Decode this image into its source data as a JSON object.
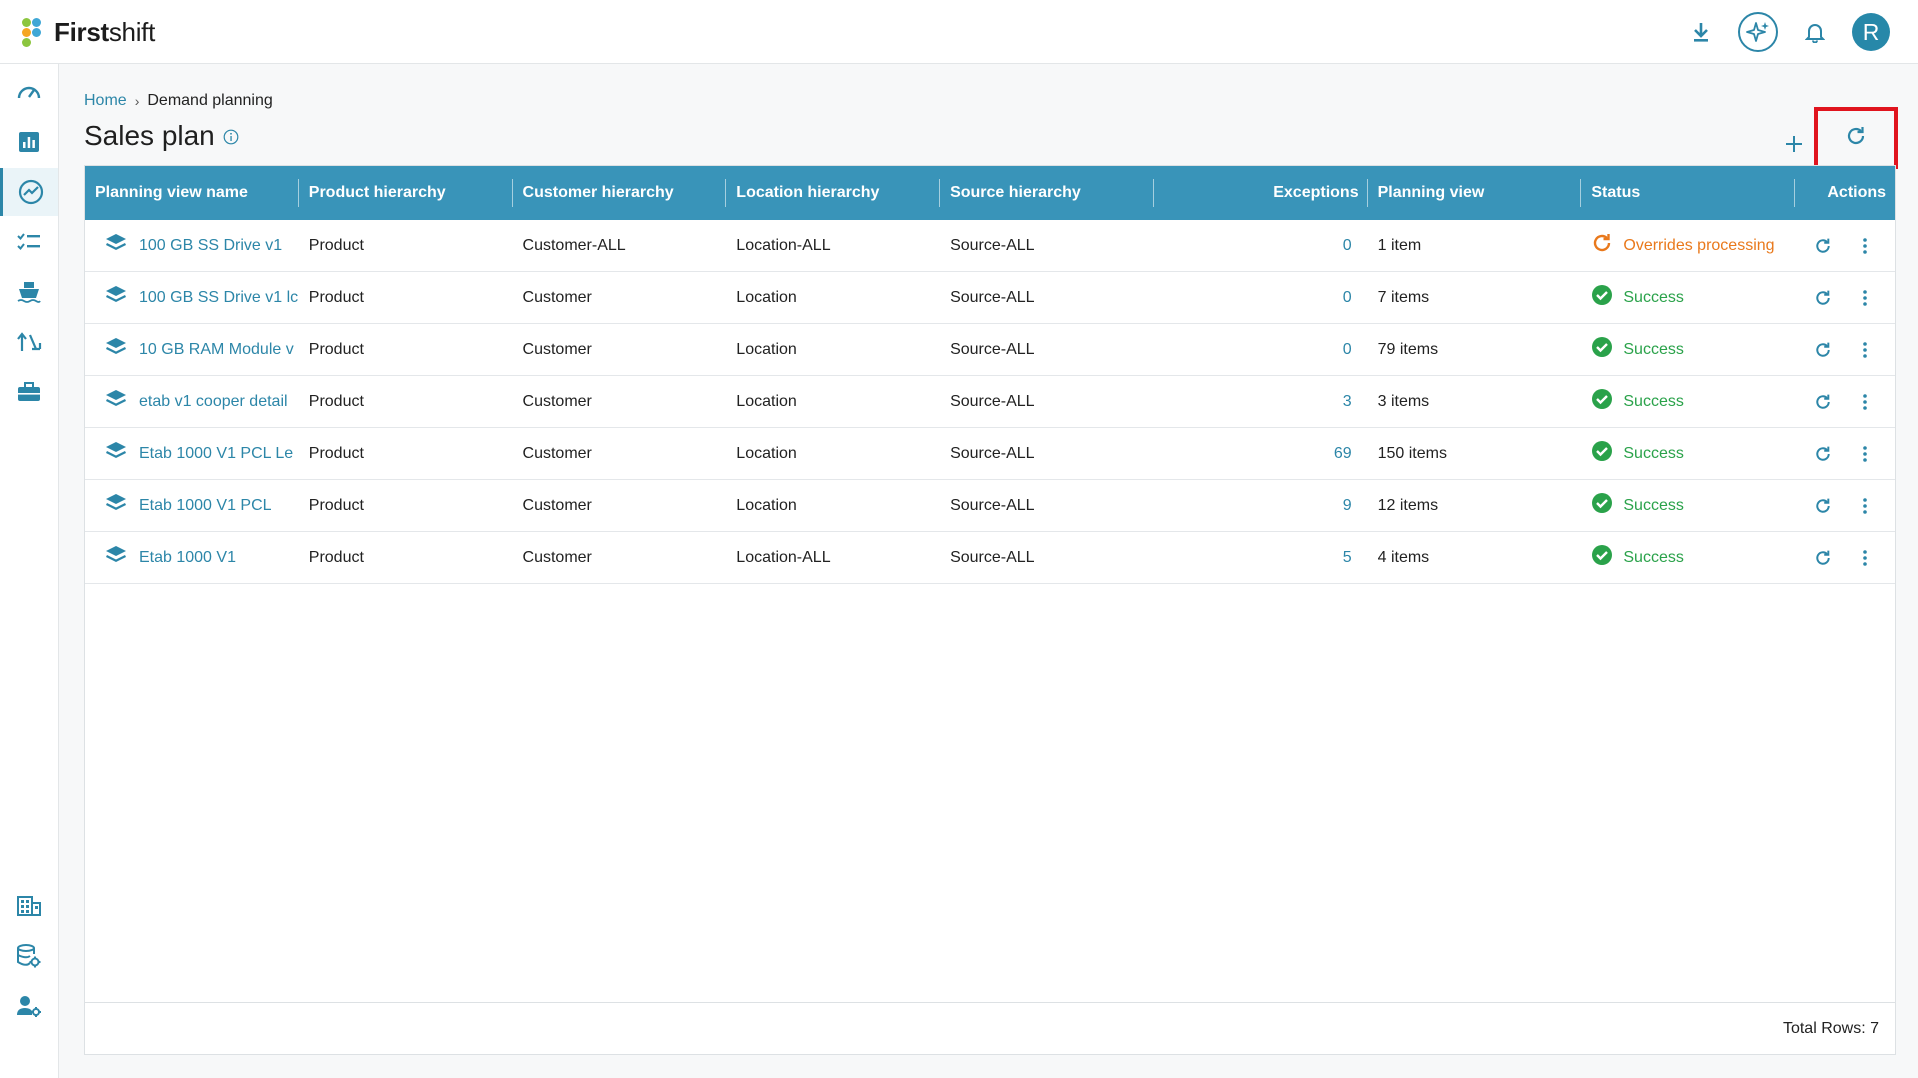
{
  "app": {
    "logo_text_bold": "First",
    "logo_text_light": "shift"
  },
  "colors": {
    "accent": "#2c86a8",
    "header_bg": "#3994b9",
    "success": "#2aa24a",
    "processing": "#e9791c",
    "highlight": "#e0141e"
  },
  "topbar": {
    "icons": [
      "download-icon",
      "ai-sparkle-icon",
      "bell-icon"
    ],
    "avatar_initial": "R"
  },
  "sidebar": {
    "items": [
      {
        "icon": "dashboard-gauge-icon"
      },
      {
        "icon": "bar-chart-icon"
      },
      {
        "icon": "trend-icon",
        "active": true
      },
      {
        "icon": "checklist-icon"
      },
      {
        "icon": "ship-icon"
      },
      {
        "icon": "route-icon"
      },
      {
        "icon": "briefcase-icon"
      },
      {
        "icon": "building-icon"
      },
      {
        "icon": "database-settings-icon"
      },
      {
        "icon": "user-settings-icon"
      }
    ]
  },
  "breadcrumb": {
    "home": "Home",
    "separator": "›",
    "current": "Demand planning"
  },
  "page": {
    "title": "Sales plan"
  },
  "table": {
    "columns": [
      "Planning view name",
      "Product hierarchy",
      "Customer hierarchy",
      "Location hierarchy",
      "Source hierarchy",
      "Exceptions",
      "Planning view",
      "Status",
      "Actions"
    ],
    "rows": [
      {
        "name": "100 GB SS Drive v1",
        "product": "Product",
        "customer": "Customer-ALL",
        "location": "Location-ALL",
        "source": "Source-ALL",
        "exceptions": "0",
        "planning_view": "1 item",
        "status": "Overrides processing",
        "status_type": "processing"
      },
      {
        "name": "100 GB SS Drive v1 lc",
        "product": "Product",
        "customer": "Customer",
        "location": "Location",
        "source": "Source-ALL",
        "exceptions": "0",
        "planning_view": "7 items",
        "status": "Success",
        "status_type": "success"
      },
      {
        "name": "10 GB RAM Module v",
        "product": "Product",
        "customer": "Customer",
        "location": "Location",
        "source": "Source-ALL",
        "exceptions": "0",
        "planning_view": "79 items",
        "status": "Success",
        "status_type": "success"
      },
      {
        "name": "etab v1 cooper detail",
        "product": "Product",
        "customer": "Customer",
        "location": "Location",
        "source": "Source-ALL",
        "exceptions": "3",
        "planning_view": "3 items",
        "status": "Success",
        "status_type": "success"
      },
      {
        "name": "Etab 1000 V1 PCL Le",
        "product": "Product",
        "customer": "Customer",
        "location": "Location",
        "source": "Source-ALL",
        "exceptions": "69",
        "planning_view": "150 items",
        "status": "Success",
        "status_type": "success"
      },
      {
        "name": "Etab 1000 V1 PCL",
        "product": "Product",
        "customer": "Customer",
        "location": "Location",
        "source": "Source-ALL",
        "exceptions": "9",
        "planning_view": "12 items",
        "status": "Success",
        "status_type": "success"
      },
      {
        "name": "Etab 1000 V1",
        "product": "Product",
        "customer": "Customer",
        "location": "Location-ALL",
        "source": "Source-ALL",
        "exceptions": "5",
        "planning_view": "4 items",
        "status": "Success",
        "status_type": "success"
      }
    ],
    "footer": "Total Rows: 7"
  }
}
